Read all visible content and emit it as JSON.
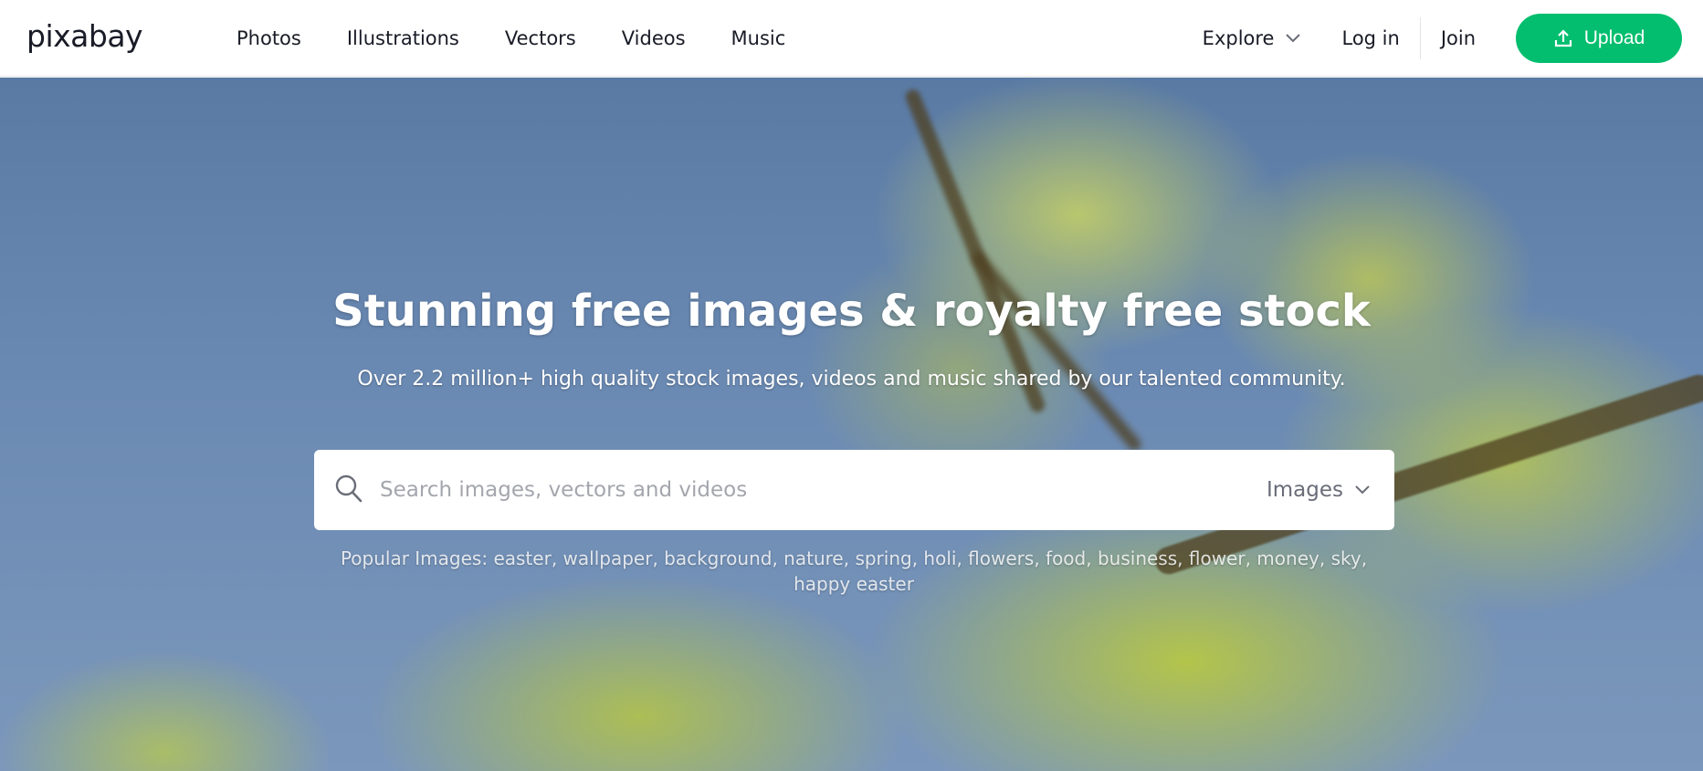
{
  "header": {
    "logo": "pixabay",
    "nav": [
      "Photos",
      "Illustrations",
      "Vectors",
      "Videos",
      "Music"
    ],
    "explore": "Explore",
    "login": "Log in",
    "join": "Join",
    "upload": "Upload"
  },
  "hero": {
    "title": "Stunning free images & royalty free stock",
    "subtitle": "Over 2.2 million+ high quality stock images, videos and music shared by our talented community.",
    "search_placeholder": "Search images, vectors and videos",
    "search_type": "Images",
    "popular_label": "Popular Images:",
    "popular_tags": [
      "easter",
      "wallpaper",
      "background",
      "nature",
      "spring",
      "holi",
      "flowers",
      "food",
      "business",
      "flower",
      "money",
      "sky",
      "happy easter"
    ]
  },
  "colors": {
    "brand_green": "#02be6e",
    "text_dark": "#191b26"
  },
  "icons": {
    "search": "search-icon",
    "explore_chevron": "chevron-down-icon",
    "upload": "upload-icon",
    "type_chevron": "chevron-down-icon"
  }
}
